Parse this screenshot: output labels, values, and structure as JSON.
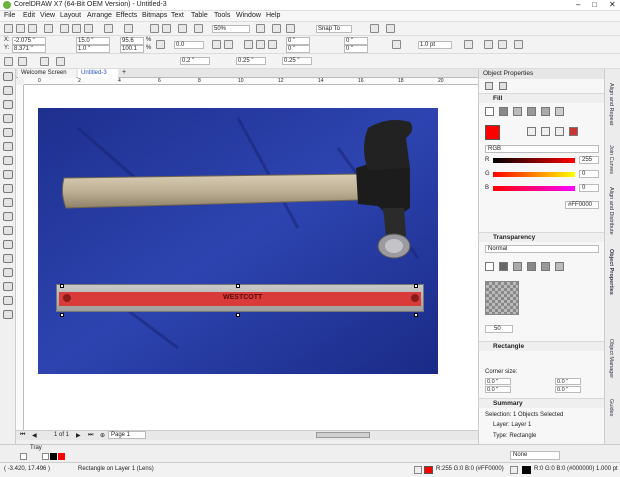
{
  "window": {
    "title": "CorelDRAW X7 (64-Bit OEM Version) - Untitled-3"
  },
  "menu": [
    "File",
    "Edit",
    "View",
    "Layout",
    "Arrange",
    "Effects",
    "Bitmaps",
    "Text",
    "Table",
    "Tools",
    "Window",
    "Help"
  ],
  "toolbar1": {
    "zoom": "50%",
    "snap": "Snap To"
  },
  "propbar": {
    "x": "-2.075 \"",
    "y": "8.371 \"",
    "w": "15.0 \"",
    "h": "1.0 \"",
    "sx": "95.6",
    "sy": "100.1",
    "pct": "%",
    "angle": "0.0",
    "corner1": "0 \"",
    "corner2": "0 \"",
    "corner3": "0 \"",
    "corner4": "0 \"",
    "outline": "1.0 pt"
  },
  "toolbar3": {
    "nudge1": "0.2 \"",
    "nudge2": "0.25 \"",
    "nudge3": "0.25 \""
  },
  "tabs": [
    "Welcome Screen",
    "Untitled-3"
  ],
  "ruler": {
    "marks": [
      "0",
      "2",
      "4",
      "6",
      "8",
      "10",
      "12",
      "14",
      "16",
      "18",
      "20"
    ]
  },
  "canvas": {
    "ruler_text": "WESTCOTT"
  },
  "pagenav": {
    "counter": "1 of 1",
    "page": "Page 1"
  },
  "panel": {
    "header": "Object Properties",
    "fill_section": "Fill",
    "color_model": "RGB",
    "r_label": "R",
    "r_value": "255",
    "g_label": "G",
    "g_value": "0",
    "b_label": "B",
    "b_value": "0",
    "hex": "#FF0000",
    "transparency_section": "Transparency",
    "blend_mode": "Normal",
    "trans_value": "50",
    "rectangle_section": "Rectangle",
    "corner_label": "Corner size:",
    "c1": "0.0 \"",
    "c2": "0.0 \"",
    "c3": "0.0 \"",
    "c4": "0.0 \"",
    "summary_section": "Summary",
    "summary_line1": "Selection: 1 Objects Selected",
    "summary_line2": "Layer: Layer 1",
    "summary_line3": "Type: Rectangle"
  },
  "sidetabs": [
    "Align and Repeat",
    "Join Curves",
    "Align and Distribute",
    "Object Properties",
    "Object Manager",
    "Guides"
  ],
  "tray": {
    "label": "Tray",
    "none": "None"
  },
  "status": {
    "coords": "( -3.420, 17.496 )",
    "info": "Rectangle on Layer 1  (Lens)",
    "fill": "R:255 G:0 B:0 (#FF0000)",
    "outline": "R:0 G:0 B:0 (#000000)  1.000 pt"
  },
  "colors": {
    "red": "#ff0000",
    "accent": "#3c5aa6",
    "blue_bg": "#2a3fa8"
  }
}
